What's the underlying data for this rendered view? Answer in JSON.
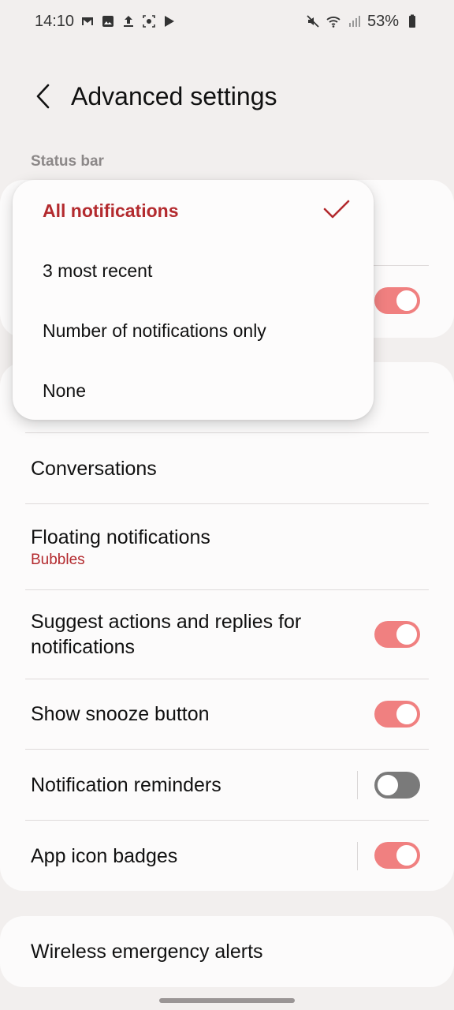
{
  "status_bar": {
    "time": "14:10",
    "battery": "53%",
    "left_icons": [
      "gmail-icon",
      "gallery-icon",
      "upload-icon",
      "screen-record-icon",
      "play-store-icon"
    ],
    "right_icons": [
      "mute-icon",
      "wifi-icon",
      "signal-icon",
      "battery-icon"
    ]
  },
  "header": {
    "title": "Advanced settings"
  },
  "section": {
    "status_bar_label": "Status bar"
  },
  "dropdown": {
    "options": [
      {
        "label": "All notifications",
        "selected": true
      },
      {
        "label": "3 most recent",
        "selected": false
      },
      {
        "label": "Number of notifications only",
        "selected": false
      },
      {
        "label": "None",
        "selected": false
      }
    ]
  },
  "settings": {
    "conversations": {
      "title": "Conversations"
    },
    "floating": {
      "title": "Floating notifications",
      "subtitle": "Bubbles"
    },
    "suggest": {
      "title_line1": "Suggest actions and replies for",
      "title_line2": "notifications",
      "on": true
    },
    "snooze": {
      "title": "Show snooze button",
      "on": true
    },
    "reminders": {
      "title": "Notification reminders",
      "on": false
    },
    "badges": {
      "title": "App icon badges",
      "on": true
    },
    "emergency": {
      "title": "Wireless emergency alerts"
    }
  },
  "colors": {
    "accent": "#b32a2e",
    "toggle_on": "#f08080",
    "background": "#f2efee"
  }
}
